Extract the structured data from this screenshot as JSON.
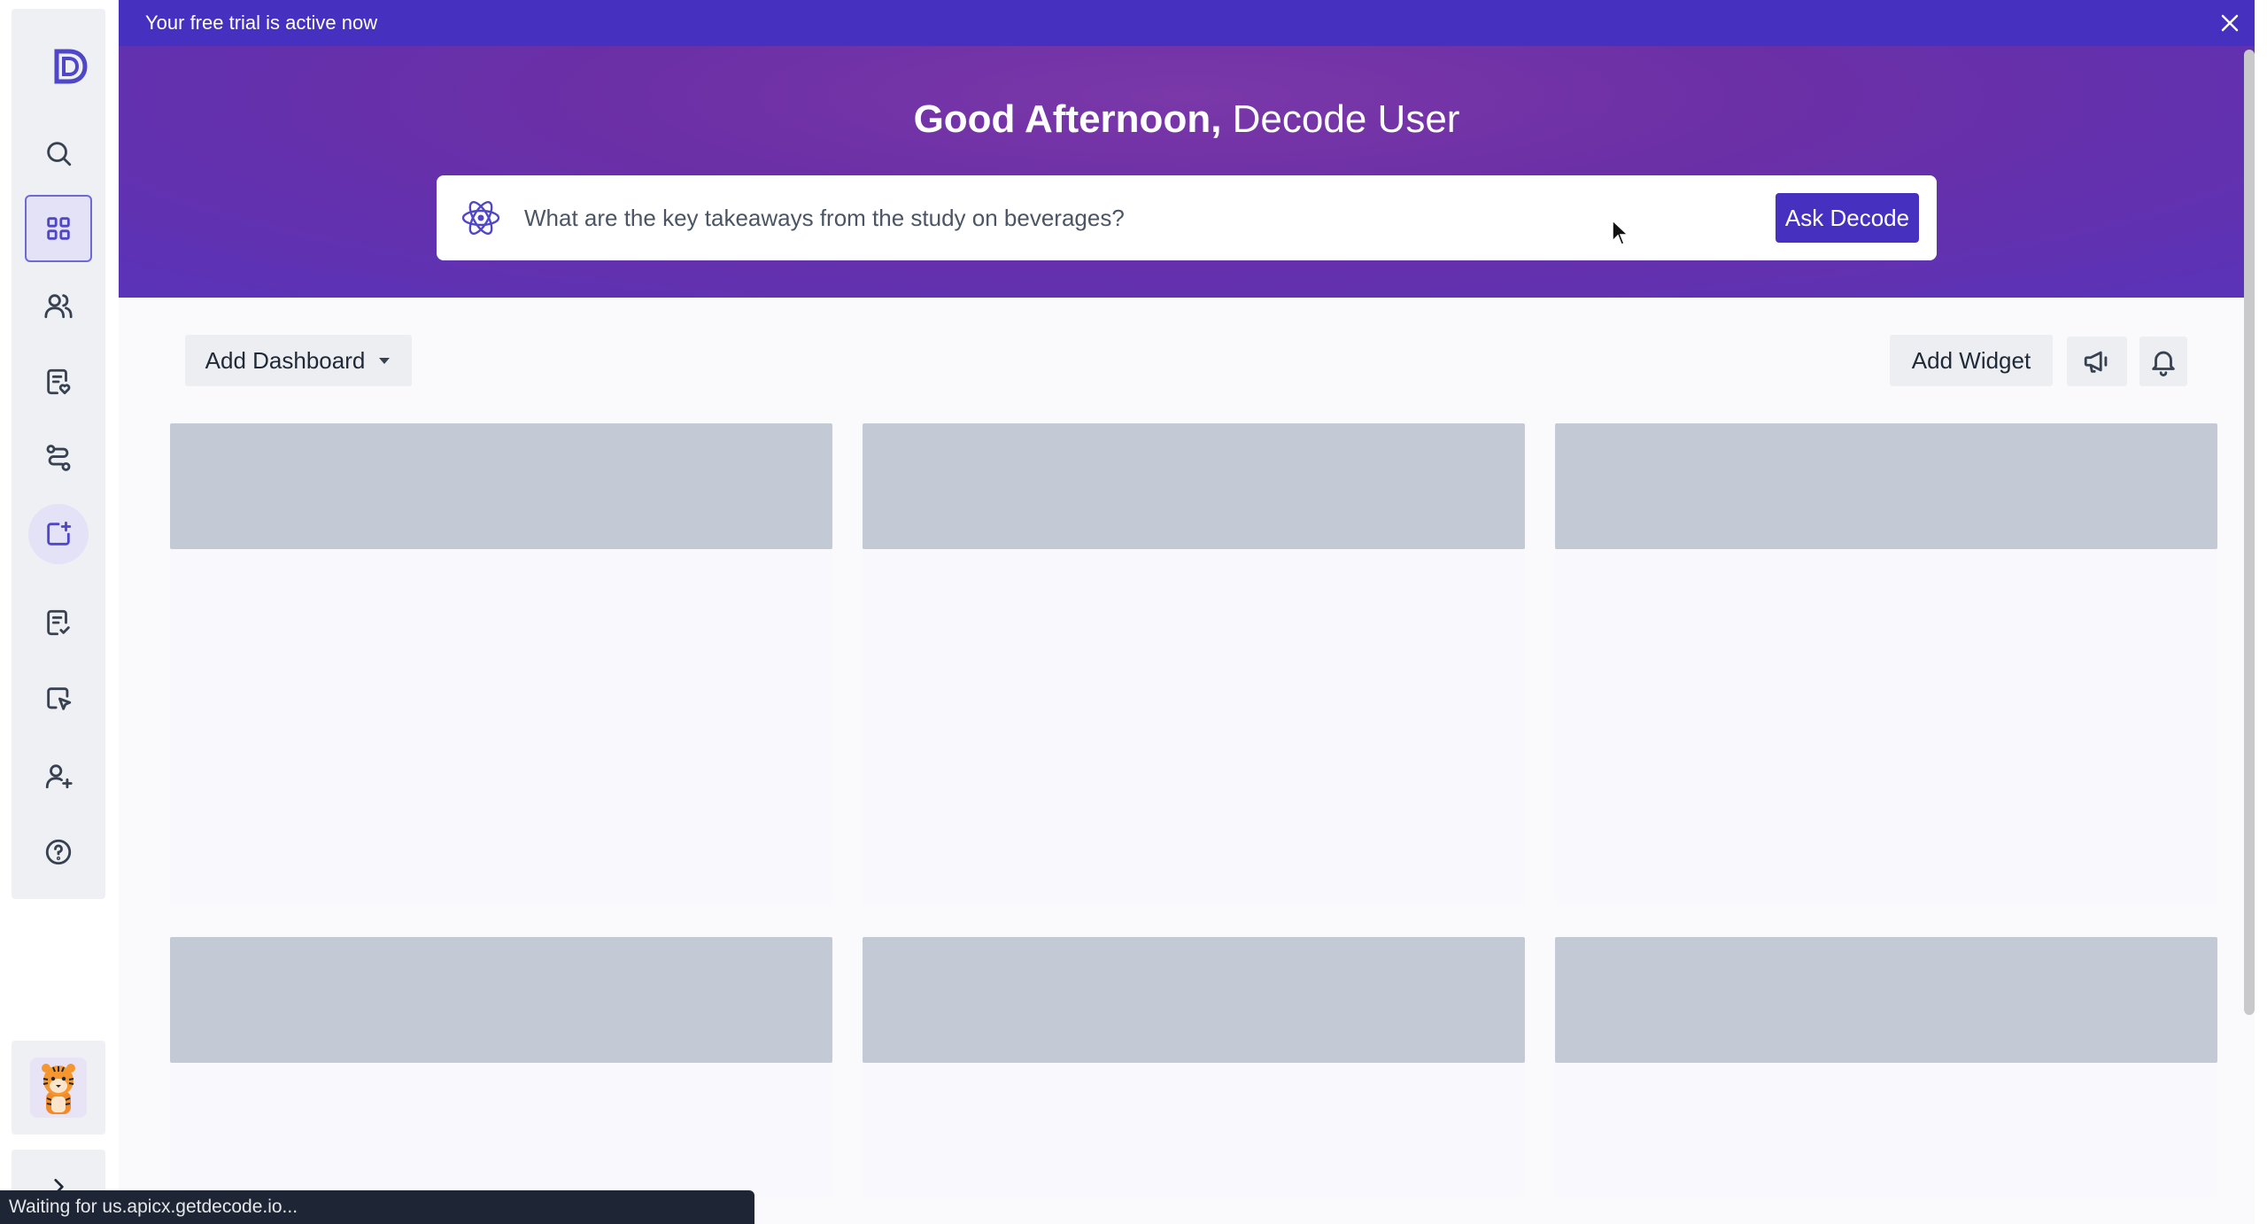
{
  "sidebar": {
    "logo_letter": "D",
    "items": [
      {
        "name": "search",
        "icon": "search-icon"
      },
      {
        "name": "dashboard",
        "icon": "grid-icon",
        "active": true
      },
      {
        "name": "users",
        "icon": "users-icon"
      },
      {
        "name": "reports",
        "icon": "document-heart-icon"
      },
      {
        "name": "journeys",
        "icon": "route-icon"
      },
      {
        "name": "create",
        "icon": "add-square-icon"
      },
      {
        "name": "tasks",
        "icon": "clipboard-check-icon"
      },
      {
        "name": "interactions",
        "icon": "pointer-icon"
      },
      {
        "name": "invite",
        "icon": "user-plus-icon"
      },
      {
        "name": "help",
        "icon": "help-circle-icon"
      }
    ],
    "expand_icon": "chevron-right-icon",
    "avatar": "tiger-avatar"
  },
  "banner": {
    "text": "Your free trial is active now"
  },
  "hero": {
    "greeting": "Good Afternoon,",
    "user_name": "Decode User",
    "ask_placeholder": "What are the key takeaways from the study on beverages?",
    "ask_button": "Ask Decode"
  },
  "toolbar": {
    "add_dashboard": "Add Dashboard",
    "add_widget": "Add Widget"
  },
  "status_bar": {
    "text": "Waiting for us.apicx.getdecode.io..."
  },
  "colors": {
    "brand": "#4530c0",
    "hero_gradient": "#7a38a8",
    "skeleton": "#c4cad5"
  }
}
